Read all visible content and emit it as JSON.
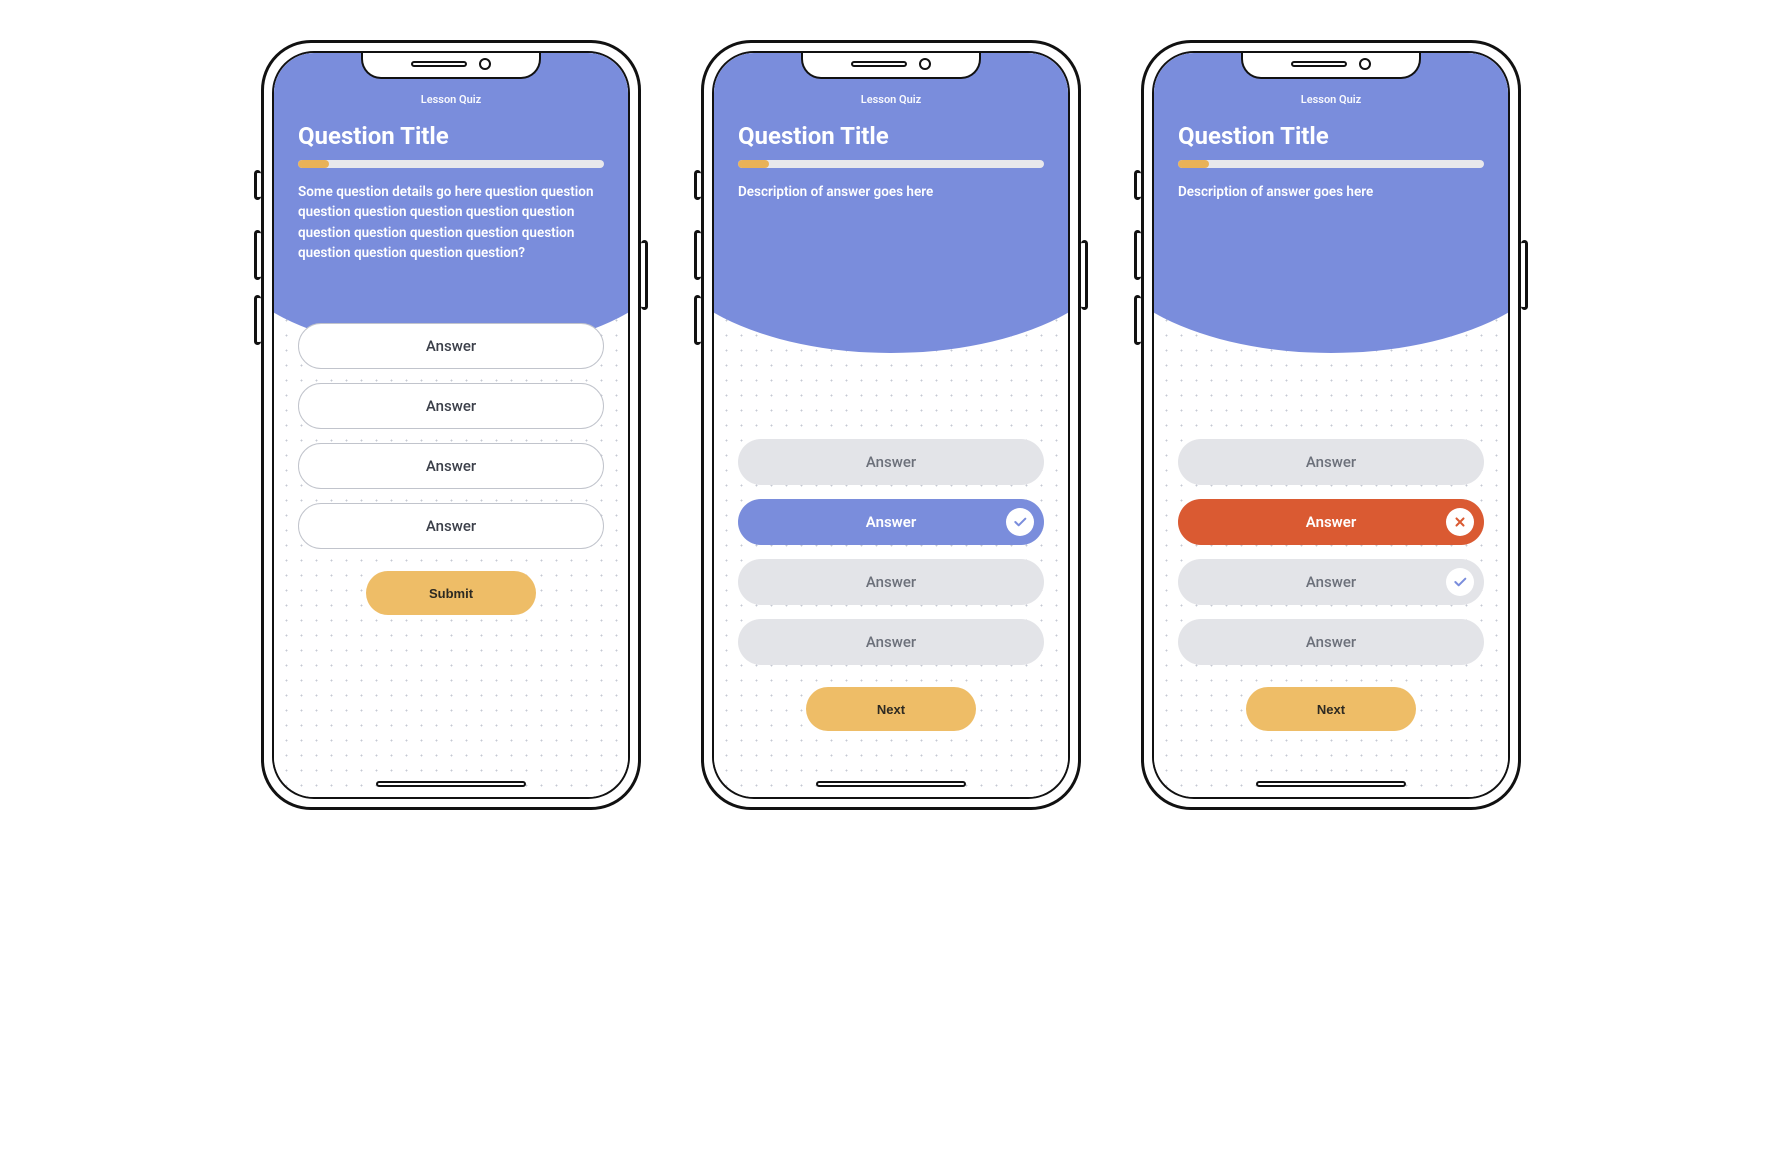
{
  "colors": {
    "primary": "#7a8ddc",
    "accent": "#eebd67",
    "danger": "#da5a32",
    "muted": "#e3e4e8"
  },
  "screens": [
    {
      "lesson_label": "Lesson Quiz",
      "title": "Question Title",
      "progress_pct": 10,
      "description": "Some question details go here question question question question question question question question question question question question question question question question?",
      "answers": [
        {
          "label": "Answer",
          "style": "outline",
          "indicator": null
        },
        {
          "label": "Answer",
          "style": "outline",
          "indicator": null
        },
        {
          "label": "Answer",
          "style": "outline",
          "indicator": null
        },
        {
          "label": "Answer",
          "style": "outline",
          "indicator": null
        }
      ],
      "action_label": "Submit"
    },
    {
      "lesson_label": "Lesson Quiz",
      "title": "Question Title",
      "progress_pct": 10,
      "description": "Description of answer goes here",
      "answers": [
        {
          "label": "Answer",
          "style": "muted",
          "indicator": null
        },
        {
          "label": "Answer",
          "style": "correct",
          "indicator": "check"
        },
        {
          "label": "Answer",
          "style": "muted",
          "indicator": null
        },
        {
          "label": "Answer",
          "style": "muted",
          "indicator": null
        }
      ],
      "action_label": "Next"
    },
    {
      "lesson_label": "Lesson Quiz",
      "title": "Question Title",
      "progress_pct": 10,
      "description": "Description of answer goes here",
      "answers": [
        {
          "label": "Answer",
          "style": "muted",
          "indicator": null
        },
        {
          "label": "Answer",
          "style": "wrong",
          "indicator": "cross"
        },
        {
          "label": "Answer",
          "style": "muted",
          "indicator": "check-blue"
        },
        {
          "label": "Answer",
          "style": "muted",
          "indicator": null
        }
      ],
      "action_label": "Next"
    }
  ]
}
